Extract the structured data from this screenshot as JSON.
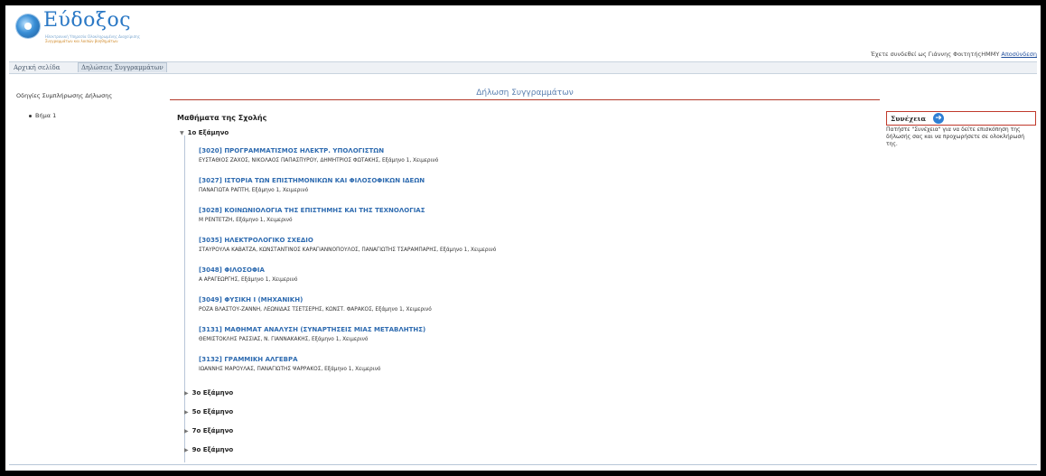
{
  "header": {
    "logo_title": "Εύδοξος",
    "logo_sub1": "Ηλεκτρονική Υπηρεσία Ολοκληρωμένης Διαχείρισης",
    "logo_sub2": "Συγγραμμάτων και λοιπών βοηθημάτων",
    "user_text": "Έχετε συνδεθεί ως Γιάννης ΦοιτητήςΗΜΜΥ",
    "logout_label": "Αποσύνδεση"
  },
  "nav": {
    "items": [
      {
        "label": "Αρχική σελίδα"
      },
      {
        "label": "Δηλώσεις Συγγραμμάτων"
      }
    ]
  },
  "sidebar": {
    "title": "Οδηγίες Συμπλήρωσης Δήλωσης",
    "step": "Βήμα 1"
  },
  "main": {
    "title": "Δήλωση Συγγραμμάτων",
    "school_heading": "Μαθήματα της Σχολής",
    "open_semester": "1ο Εξάμηνο",
    "courses": [
      {
        "title": "[3020] ΠΡΟΓΡΑΜΜΑΤΙΣΜΟΣ ΗΛΕΚΤΡ. ΥΠΟΛΟΓΙΣΤΩΝ",
        "info": "ΕΥΣΤΑΘΙΟΣ ΖΑΧΟΣ, ΝΙΚΟΛΑΟΣ ΠΑΠΑΣΠΥΡΟΥ, ΔΗΜΗΤΡΙΟΣ ΦΩΤΑΚΗΣ, Εξάμηνο 1, Χειμερινό"
      },
      {
        "title": "[3027] ΙΣΤΟΡΙΑ ΤΩΝ ΕΠΙΣΤΗΜΟΝΙΚΩΝ ΚΑΙ ΦΙΛΟΣΟΦΙΚΩΝ ΙΔΕΩΝ",
        "info": "ΠΑΝΑΓΙΩΤΑ ΡΑΠΤΗ, Εξάμηνο 1, Χειμερινό"
      },
      {
        "title": "[3028] ΚΟΙΝΩΝΙΟΛΟΓΙΑ ΤΗΣ ΕΠΙΣΤΗΜΗΣ ΚΑΙ ΤΗΣ ΤΕΧΝΟΛΟΓΙΑΣ",
        "info": "Μ ΡΕΝΤΕΤΖΗ, Εξάμηνο 1, Χειμερινό"
      },
      {
        "title": "[3035] ΗΛΕΚΤΡΟΛΟΓΙΚΟ ΣΧΕΔΙΟ",
        "info": "ΣΤΑΥΡΟΥΛΑ ΚΑΒΑΤΖΑ, ΚΩΝΣΤΑΝΤΙΝΟΣ ΚΑΡΑΓΙΑΝΝΟΠΟΥΛΟΣ, ΠΑΝΑΓΙΩΤΗΣ ΤΣΑΡΑΜΠΑΡΗΣ, Εξάμηνο 1, Χειμερινό"
      },
      {
        "title": "[3048] ΦΙΛΟΣΟΦΙΑ",
        "info": "Α ΑΡΑΓΕΩΡΓΗΣ, Εξάμηνο 1, Χειμερινό"
      },
      {
        "title": "[3049] ΦΥΣΙΚΗ Ι (ΜΗΧΑΝΙΚΗ)",
        "info": "ΡΟΖΑ ΒΛΑΣΤΟΥ-ΖΑΝΝΗ, ΛΕΩΝΙΔΑΣ ΤΣΕΤΣΕΡΗΣ, ΚΩΝΣΤ. ΦΑΡΑΚΟΣ, Εξάμηνο 1, Χειμερινό"
      },
      {
        "title": "[3131] ΜΑΘΗΜΑΤ ΑΝΑΛΥΣΗ (ΣΥΝΑΡΤΗΣΕΙΣ ΜΙΑΣ ΜΕΤΑΒΛΗΤΗΣ)",
        "info": "ΘΕΜΙΣΤΟΚΛΗΣ ΡΑΣΣΙΑΣ, Ν. ΓΙΑΝΝΑΚΑΚΗΣ, Εξάμηνο 1, Χειμερινό"
      },
      {
        "title": "[3132] ΓΡΑΜΜΙΚΗ ΑΛΓΕΒΡΑ",
        "info": "ΙΩΑΝΝΗΣ ΜΑΡΟΥΛΑΣ, ΠΑΝΑΓΙΩΤΗΣ ΨΑΡΡΑΚΟΣ, Εξάμηνο 1, Χειμερινό"
      }
    ],
    "closed_semesters": [
      "3ο Εξάμηνο",
      "5ο Εξάμηνο",
      "7ο Εξάμηνο",
      "9ο Εξάμηνο"
    ]
  },
  "right_panel": {
    "continue_label": "Συνέχεια",
    "help_text": "Πατήστε \"Συνέχεια\" για να δείτε επισκόπηση της δήλωσής σας και να προχωρήσετε σε ολοκλήρωσή της."
  }
}
